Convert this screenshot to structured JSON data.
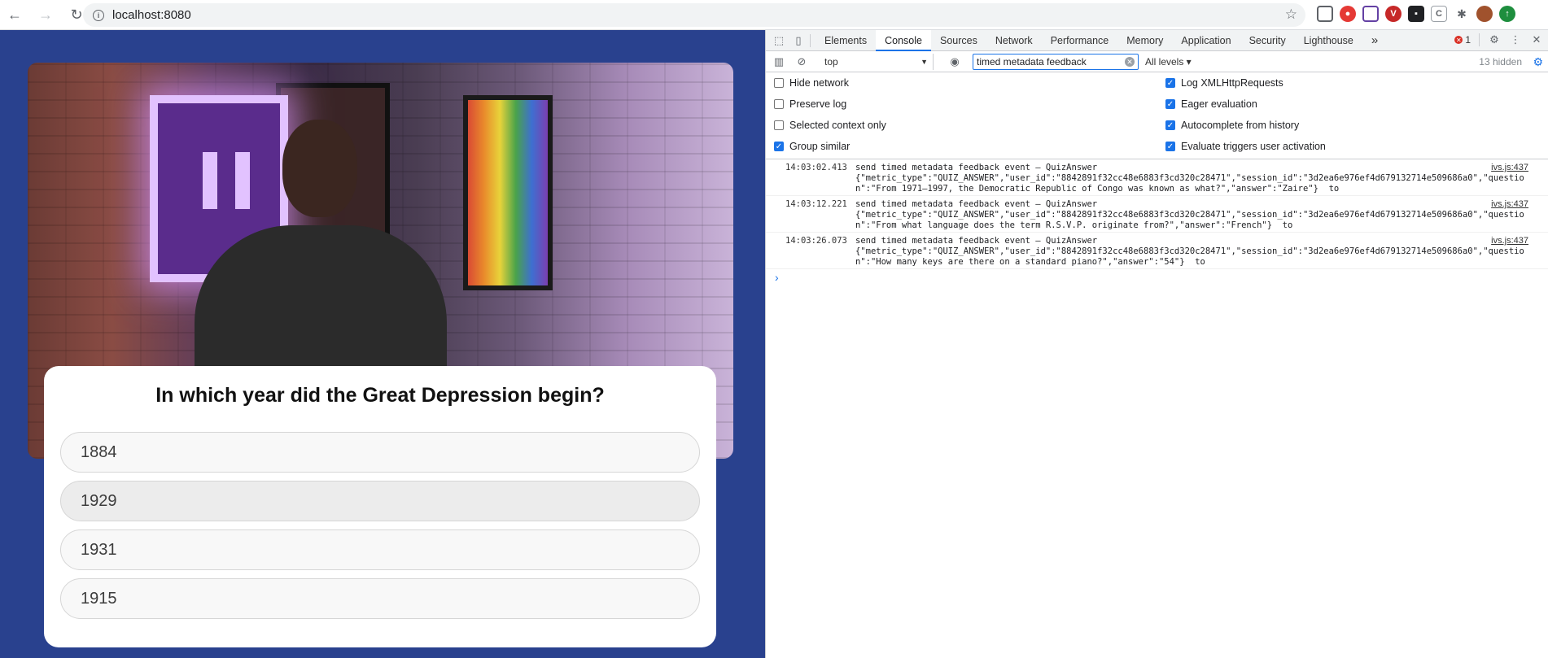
{
  "browser": {
    "url": "localhost:8080"
  },
  "quiz": {
    "question": "In which year did the Great Depression begin?",
    "answers": [
      "1884",
      "1929",
      "1931",
      "1915"
    ]
  },
  "devtools": {
    "tabs": [
      "Elements",
      "Console",
      "Sources",
      "Network",
      "Performance",
      "Memory",
      "Application",
      "Security",
      "Lighthouse"
    ],
    "more_tabs": "»",
    "error_count": "1",
    "context": "top",
    "filter": "timed metadata feedback",
    "levels": "All levels ▾",
    "hidden": "13 hidden",
    "settings": {
      "hide_network": "Hide network",
      "preserve_log": "Preserve log",
      "selected_context": "Selected context only",
      "group_similar": "Group similar",
      "log_xhr": "Log XMLHttpRequests",
      "eager_eval": "Eager evaluation",
      "autocomplete": "Autocomplete from history",
      "eval_triggers": "Evaluate triggers user activation"
    },
    "logs": [
      {
        "time": "14:03:02.413",
        "message": "send timed metadata feedback event – QuizAnswer\n{\"metric_type\":\"QUIZ_ANSWER\",\"user_id\":\"8842891f32cc48e6883f3cd320c28471\",\"session_id\":\"3d2ea6e976ef4d679132714e509686a0\",\"question\":\"From 1971–1997, the Democratic Republic of Congo was known as what?\",\"answer\":\"Zaire\"}  to",
        "source": "ivs.js:437"
      },
      {
        "time": "14:03:12.221",
        "message": "send timed metadata feedback event – QuizAnswer\n{\"metric_type\":\"QUIZ_ANSWER\",\"user_id\":\"8842891f32cc48e6883f3cd320c28471\",\"session_id\":\"3d2ea6e976ef4d679132714e509686a0\",\"question\":\"From what language does the term R.S.V.P. originate from?\",\"answer\":\"French\"}  to",
        "source": "ivs.js:437"
      },
      {
        "time": "14:03:26.073",
        "message": "send timed metadata feedback event – QuizAnswer\n{\"metric_type\":\"QUIZ_ANSWER\",\"user_id\":\"8842891f32cc48e6883f3cd320c28471\",\"session_id\":\"3d2ea6e976ef4d679132714e509686a0\",\"question\":\"How many keys are there on a standard piano?\",\"answer\":\"54\"}  to",
        "source": "ivs.js:437"
      }
    ],
    "prompt": "›"
  },
  "colors": {
    "app_background": "#29418e",
    "devtools_accent": "#1a73e8"
  }
}
